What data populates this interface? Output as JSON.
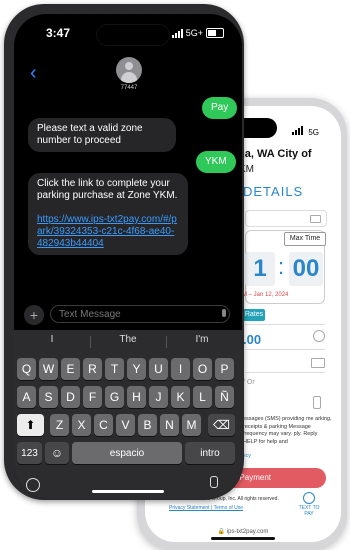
{
  "messages_app": {
    "status_time": "3:47",
    "network": "5G+",
    "contact_number": "77447",
    "messages": [
      {
        "direction": "outgoing",
        "text": "Pay"
      },
      {
        "direction": "incoming",
        "text": "Please text a valid zone number to proceed"
      },
      {
        "direction": "outgoing",
        "text": "YKM"
      },
      {
        "direction": "incoming",
        "text": "Click the link to complete your parking purchase at Zone YKM.",
        "link": "https://www.ips-txt2pay.com/#/park/39324353-c21c-4f68-ae40-482943b44404"
      }
    ],
    "compose_placeholder": "Text Message",
    "suggestions": [
      "I",
      "The",
      "I'm"
    ],
    "keyboard": {
      "row1": [
        "Q",
        "W",
        "E",
        "R",
        "T",
        "Y",
        "U",
        "I",
        "O",
        "P"
      ],
      "row2": [
        "A",
        "S",
        "D",
        "F",
        "G",
        "H",
        "J",
        "K",
        "L",
        "Ñ"
      ],
      "row3": [
        "Z",
        "X",
        "C",
        "V",
        "B",
        "N",
        "M"
      ],
      "numbers_key": "123",
      "space_key": "espacio",
      "return_key": "intro"
    }
  },
  "parking_page": {
    "status_network": "5G",
    "title_partial": "ma, WA City of",
    "subtitle_partial": "KM",
    "section_partial": "DETAILS",
    "max_time_label": "Max Time",
    "time_digits": [
      "1",
      "00"
    ],
    "date_partial": "M – Jan 12, 2024",
    "rates_label": "Rates",
    "amount_partial": ".00",
    "or_partial": "/ Or",
    "terms_text": "essages (SMS) providing me arking, receipts & parking Message frequency may vary. ply. Reply HELP for help and",
    "policy_partial": "licy",
    "pay_button": "to Payment",
    "copyright": "© 2007 - 2023  IPS Group, Inc. All rights reserved.",
    "privacy_link": "Privacy Statement",
    "terms_link": "Terms of Use",
    "text_to_pay": "TEXT TO PAY",
    "url": "ips-txt2pay.com"
  }
}
